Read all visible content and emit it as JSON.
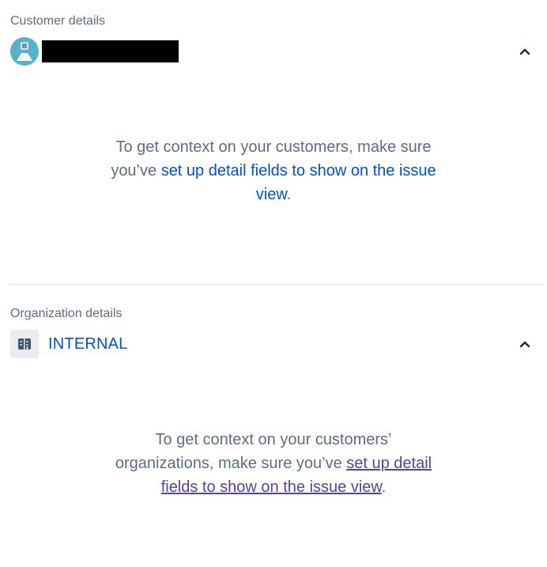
{
  "customer": {
    "section_label": "Customer details",
    "message_line1": "To get context on your customers, make sure",
    "message_line2_prefix": "you’ve ",
    "link_text_part1": "set up detail fields to show on the issue",
    "link_text_part2": "view",
    "message_suffix": "."
  },
  "organization": {
    "section_label": "Organization details",
    "name": "INTERNAL",
    "message_line1": "To get context on your customers’",
    "message_line2_prefix": "organizations, make sure you’ve ",
    "link_text_part1": "set up detail",
    "link_text_part2": "fields to show on the issue view",
    "message_suffix": "."
  },
  "icons": {
    "avatar": "customer-avatar",
    "org": "building-icon",
    "collapse": "chevron-up-icon"
  },
  "colors": {
    "link": "#0052cc",
    "visited_link": "#5243aa",
    "muted_text": "#5e6c84",
    "divider": "#dfe1e6"
  }
}
